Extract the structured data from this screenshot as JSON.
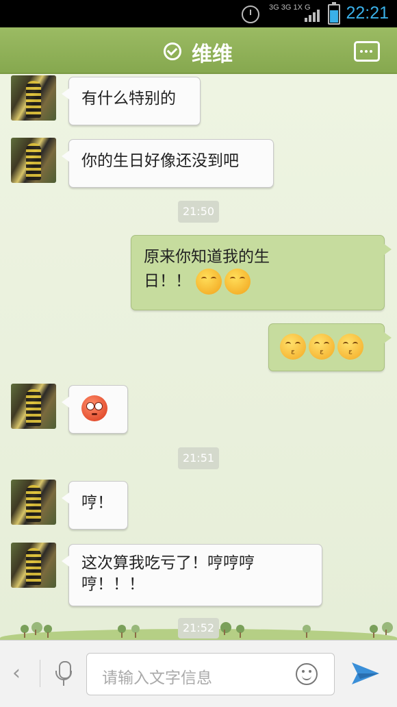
{
  "status_bar": {
    "time": "22:21",
    "network": "3G 3G 1X G"
  },
  "header": {
    "contact_name": "维维"
  },
  "messages": [
    {
      "side": "in",
      "text": "有什么特别的"
    },
    {
      "side": "in",
      "text": "你的生日好像还没到吧"
    },
    {
      "type": "timestamp",
      "text": "21:50"
    },
    {
      "side": "out",
      "text_line1": "原来你知道我的生",
      "text_line2": "日！！",
      "emojis": [
        "blush-emoji",
        "blush-emoji"
      ]
    },
    {
      "side": "out",
      "emojis": [
        "kiss-emoji",
        "kiss-emoji",
        "kiss-emoji"
      ]
    },
    {
      "side": "in",
      "emojis": [
        "flushed-emoji"
      ]
    },
    {
      "type": "timestamp",
      "text": "21:51"
    },
    {
      "side": "in",
      "text": "哼！"
    },
    {
      "side": "in",
      "text_line1": "这次算我吃亏了！哼哼哼",
      "text_line2": "哼！！！"
    },
    {
      "type": "timestamp",
      "text": "21:52"
    }
  ],
  "input_bar": {
    "placeholder": "请输入文字信息"
  },
  "colors": {
    "header": "#8fb058",
    "outgoing_bubble": "#c6dc9e",
    "incoming_bubble": "#fbfbfb",
    "time_text": "#3ab0e8",
    "send_icon": "#3a8fd8"
  }
}
